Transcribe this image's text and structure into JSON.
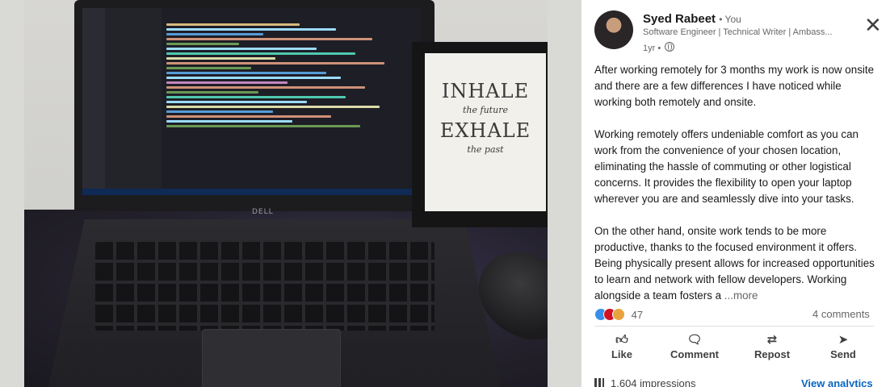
{
  "post": {
    "author_name": "Syed Rabeet",
    "you_label": "• You",
    "headline": "Software Engineer | Technical Writer | Ambass...",
    "time": "1yr •",
    "paragraphs": [
      "After working remotely for 3 months my work is now onsite and there are a few differences I have noticed while working both remotely and onsite.",
      "Working remotely offers undeniable comfort as you can work from the convenience of your chosen location, eliminating the hassle of commuting or other logistical concerns. It provides the flexibility to open your laptop wherever you are and seamlessly dive into your tasks.",
      "On the other hand, onsite work tends to be more productive, thanks to the focused environment it offers. Being physically present allows for increased opportunities to learn and network with fellow developers. Working alongside a team fosters a"
    ],
    "more_label": "...more",
    "reaction_count": "47",
    "comments_label": "4 comments",
    "actions": [
      "Like",
      "Comment",
      "Repost",
      "Send"
    ],
    "impressions": "1,604 impressions",
    "analytics_label": "View analytics"
  },
  "photo": {
    "frame_line1": "INHALE",
    "frame_line2": "the future",
    "frame_line3": "EXHALE",
    "frame_line4": "the past",
    "laptop_brand": "DELL"
  },
  "colors": {
    "accent": "#0a66c2",
    "reaction_like": "#378fe9",
    "reaction_love": "#d11124",
    "reaction_insightful": "#e7a33e"
  },
  "icons": {
    "close": "close-icon",
    "visibility": "globe-icon",
    "like": "thumbs-up-icon",
    "comment": "comment-icon",
    "repost": "repost-icon",
    "send": "send-icon",
    "impressions": "bar-chart-icon"
  }
}
